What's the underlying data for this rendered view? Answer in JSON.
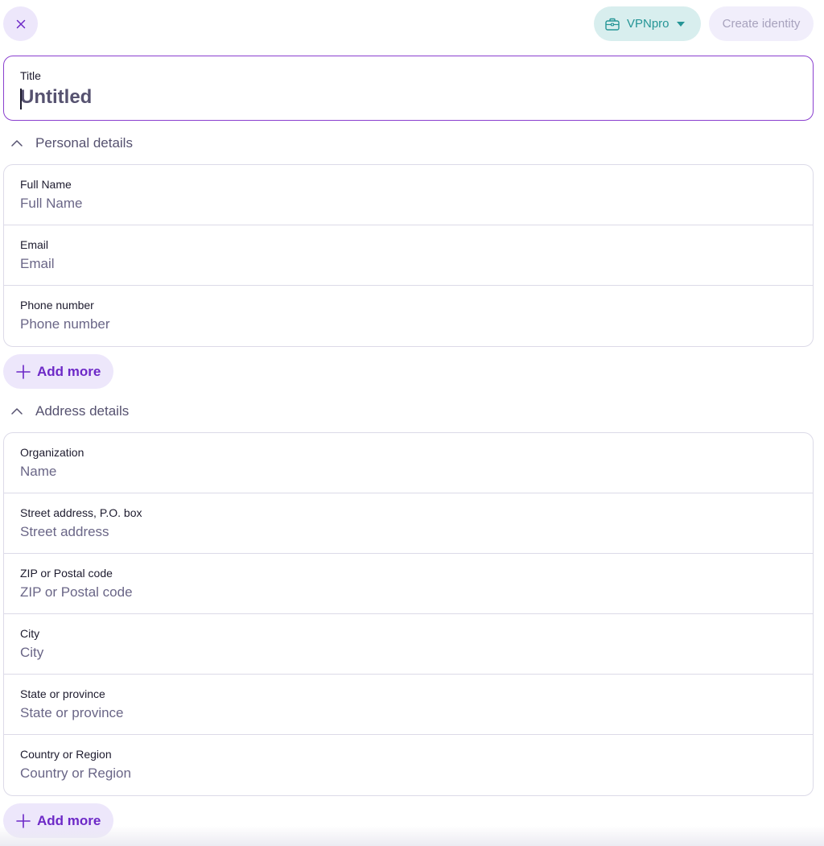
{
  "topbar": {
    "close_icon": "close-icon",
    "vault": {
      "label": "VPNpro",
      "icon": "briefcase-icon",
      "dropdown_icon": "caret-down-icon"
    },
    "create_label": "Create identity"
  },
  "title_field": {
    "label": "Title",
    "value": "Untitled"
  },
  "personal": {
    "heading": "Personal details",
    "fields": [
      {
        "label": "Full Name",
        "placeholder": "Full Name"
      },
      {
        "label": "Email",
        "placeholder": "Email"
      },
      {
        "label": "Phone number",
        "placeholder": "Phone number"
      }
    ],
    "add_more_label": "Add more"
  },
  "address": {
    "heading": "Address details",
    "fields": [
      {
        "label": "Organization",
        "placeholder": "Name"
      },
      {
        "label": "Street address, P.O. box",
        "placeholder": "Street address"
      },
      {
        "label": "ZIP or Postal code",
        "placeholder": "ZIP or Postal code"
      },
      {
        "label": "City",
        "placeholder": "City"
      },
      {
        "label": "State or province",
        "placeholder": "State or province"
      },
      {
        "label": "Country or Region",
        "placeholder": "Country or Region"
      }
    ],
    "add_more_label": "Add more"
  },
  "colors": {
    "accent": "#6d29c7",
    "vault": "#259596",
    "border_focus": "#8a3fcf"
  }
}
